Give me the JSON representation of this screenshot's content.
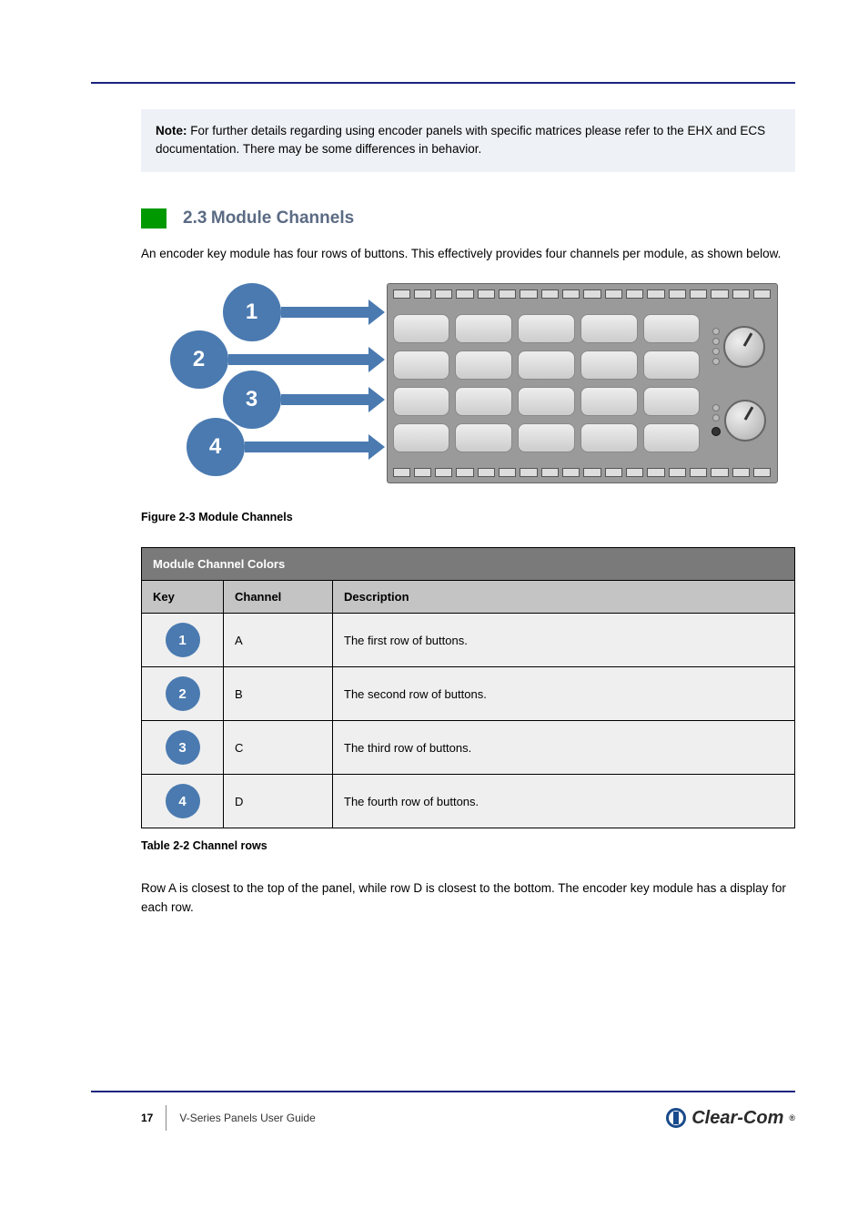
{
  "note": {
    "label": "Note:",
    "text": "For further details regarding using encoder panels with specific matrices please refer to the EHX and ECS documentation. There may be some differences in behavior."
  },
  "section": {
    "number": "2.3",
    "title": "Module Channels"
  },
  "intro": "An encoder key module has four rows of buttons. This effectively provides four channels per module, as shown below.",
  "figure": {
    "bubbles": [
      "1",
      "2",
      "3",
      "4"
    ],
    "caption": "Figure 2-3 Module Channels"
  },
  "table": {
    "title": "Module Channel Colors",
    "columns": [
      "Key",
      "Channel",
      "Description"
    ],
    "rows": [
      {
        "key": "1",
        "channel": "A",
        "description": "The first row of buttons."
      },
      {
        "key": "2",
        "channel": "B",
        "description": "The second row of buttons."
      },
      {
        "key": "3",
        "channel": "C",
        "description": "The third row of buttons."
      },
      {
        "key": "4",
        "channel": "D",
        "description": "The fourth row of buttons."
      }
    ],
    "caption": "Table 2-2 Channel rows"
  },
  "outro": "Row A is closest to the top of the panel, while row D is closest to the bottom. The encoder key module has a display for each row.",
  "footer": {
    "page": "17",
    "doc": "V-Series Panels User Guide",
    "brand": "Clear-Com"
  }
}
